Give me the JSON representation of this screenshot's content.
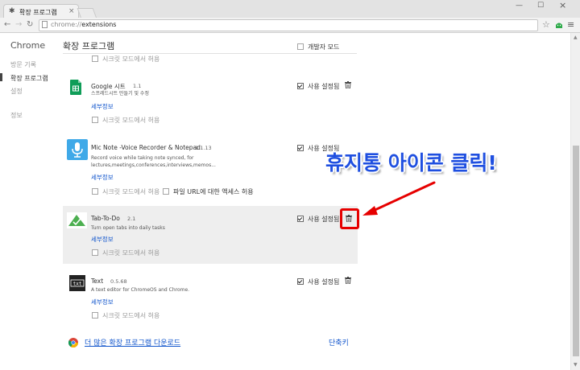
{
  "browser": {
    "tab_title": "확장 프로그램",
    "tab_icon": "puzzle-icon",
    "url_scheme": "chrome://",
    "url_path": "extensions"
  },
  "sidebar": {
    "title": "Chrome",
    "items": [
      {
        "label": "방문 기록",
        "active": false
      },
      {
        "label": "확장 프로그램",
        "active": true
      },
      {
        "label": "설정",
        "active": false
      },
      {
        "label": "정보",
        "active": false
      }
    ]
  },
  "main": {
    "title": "확장 프로그램",
    "developer_mode_label": "개발자 모드",
    "top_incognito_label": "시크릿 모드에서 허용",
    "extensions": [
      {
        "name": "Google 시트",
        "version": "1.1",
        "description": [
          "스프레드시트 만들기 및 수정"
        ],
        "details_label": "세부정보",
        "incognito_label": "시크릿 모드에서 허용",
        "enabled_label": "사용 설정됨",
        "icon": "google-sheets-icon",
        "icon_color": "#0f9d58"
      },
      {
        "name": "Mic Note -Voice Recorder & Notepad",
        "version": "1.1.13",
        "description": [
          "Record voice while taking note synced, for",
          "lectures,meetings,conferences,interviews,memos..."
        ],
        "details_label": "세부정보",
        "incognito_label": "시크릿 모드에서 허용",
        "file_url_label": "파일 URL에 대한 액세스 허용",
        "enabled_label": "사용 설정됨",
        "icon": "microphone-icon",
        "icon_color": "#3fa9e8"
      },
      {
        "name": "Tab-To-Do",
        "version": "2.1",
        "description": [
          "Turn open tabs into daily tasks"
        ],
        "details_label": "세부정보",
        "incognito_label": "시크릿 모드에서 허용",
        "enabled_label": "사용 설정됨",
        "icon": "green-checkmark-icon",
        "icon_color": "#4caf50"
      },
      {
        "name": "Text",
        "version": "0.5.68",
        "description": [
          "A text editor for ChromeOS and Chrome."
        ],
        "details_label": "세부정보",
        "incognito_label": "시크릿 모드에서 허용",
        "enabled_label": "사용 설정됨",
        "icon": "text-editor-icon",
        "icon_color": "#222222"
      }
    ],
    "more_extensions_label": "더 많은 확장 프로그램 다운로드",
    "shortcuts_label": "단축키"
  },
  "annotation": {
    "text": "휴지통 아이콘 클릭!",
    "color": "#1f4fe0",
    "arrow_color": "#e60000"
  }
}
